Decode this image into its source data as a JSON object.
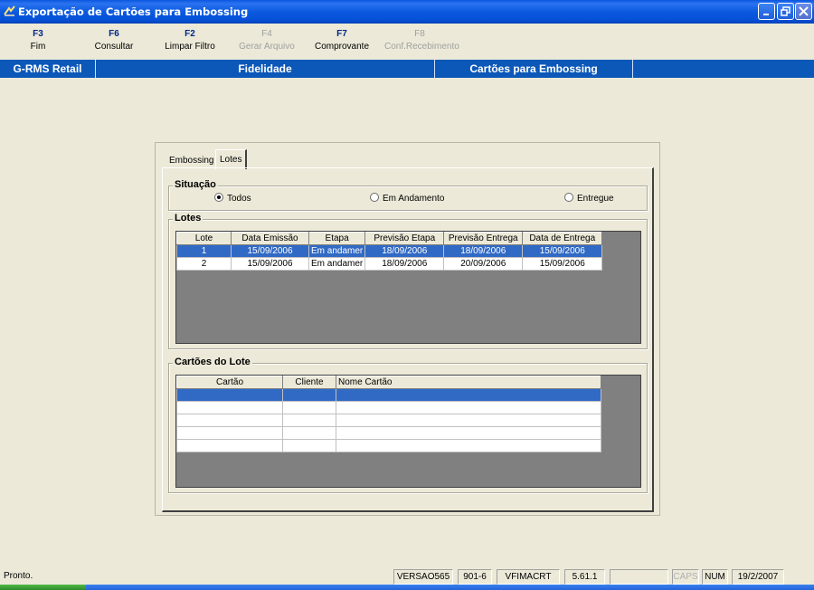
{
  "window": {
    "title": "Exportação de Cartões para Embossing"
  },
  "toolbar": {
    "buttons": [
      {
        "key": "F3",
        "label": "Fim",
        "enabled": true
      },
      {
        "key": "F6",
        "label": "Consultar",
        "enabled": true
      },
      {
        "key": "F2",
        "label": "Limpar Filtro",
        "enabled": true
      },
      {
        "key": "F4",
        "label": "Gerar Arquivo",
        "enabled": false
      },
      {
        "key": "F7",
        "label": "Comprovante",
        "enabled": true
      },
      {
        "key": "F8",
        "label": "Conf.Recebimento",
        "enabled": false
      }
    ]
  },
  "infobar": {
    "system": "G-RMS Retail",
    "module": "Fidelidade",
    "screen": "Cartões para Embossing"
  },
  "tabs": [
    {
      "label": "Embossing"
    },
    {
      "label": "Lotes"
    }
  ],
  "situacao": {
    "title": "Situação",
    "options": [
      {
        "label": "Todos",
        "selected": true
      },
      {
        "label": "Em Andamento",
        "selected": false
      },
      {
        "label": "Entregue",
        "selected": false
      }
    ]
  },
  "lotes": {
    "title": "Lotes",
    "columns": [
      "Lote",
      "Data Emissão",
      "Etapa",
      "Previsão Etapa",
      "Previsão Entrega",
      "Data de Entrega"
    ],
    "rows": [
      [
        "1",
        "15/09/2006",
        "Em andamer",
        "18/09/2006",
        "18/09/2006",
        "15/09/2006"
      ],
      [
        "2",
        "15/09/2006",
        "Em andamer",
        "18/09/2006",
        "20/09/2006",
        "15/09/2006"
      ]
    ]
  },
  "cartoes": {
    "title": "Cartões do Lote",
    "columns": [
      "Cartão",
      "Cliente",
      "Nome Cartão"
    ]
  },
  "statusbar": {
    "message": "Pronto.",
    "version": "VERSAO565",
    "store": "901-6",
    "program": "VFIMACRT",
    "build": "5.61.1",
    "blank": "",
    "caps": "CAPS",
    "num": "NUM",
    "date": "19/2/2007"
  },
  "colors": {
    "title_bar": "#0a58e0",
    "info_bar": "#0c58b8",
    "selection": "#316ac5",
    "window_bg": "#ece9d8"
  }
}
